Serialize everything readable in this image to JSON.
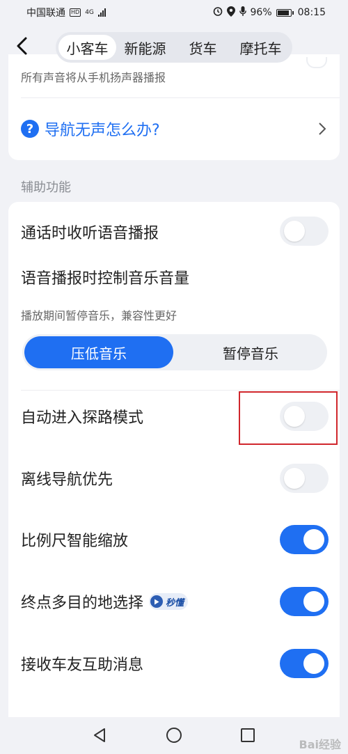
{
  "status_bar": {
    "carrier": "中国联通",
    "hd": "HD",
    "network": "4G",
    "battery": "96%",
    "time": "08:15"
  },
  "header": {
    "tabs": [
      "小客车",
      "新能源",
      "货车",
      "摩托车"
    ],
    "active_tab": "小客车"
  },
  "top_card": {
    "speaker_text": "所有声音将从手机扬声器播报",
    "help_link": "导航无声怎么办?"
  },
  "section_title": "辅助功能",
  "settings": {
    "call_broadcast": {
      "label": "通话时收听语音播报",
      "enabled": false
    },
    "music_control": {
      "label": "语音播报时控制音乐音量",
      "sub": "播放期间暂停音乐，兼容性更好",
      "options": [
        "压低音乐",
        "暂停音乐"
      ],
      "selected": "压低音乐"
    },
    "explore_mode": {
      "label": "自动进入探路模式",
      "enabled": false
    },
    "offline_first": {
      "label": "离线导航优先",
      "enabled": false
    },
    "smart_zoom": {
      "label": "比例尺智能缩放",
      "enabled": true
    },
    "multi_destination": {
      "label": "终点多目的地选择",
      "badge": "秒懂",
      "enabled": true
    },
    "rider_messages": {
      "label": "接收车友互助消息",
      "enabled": true
    }
  },
  "watermark": "Bai经验",
  "colors": {
    "accent": "#1f6ff2",
    "highlight": "#d0262c",
    "toggle_off": "#eef0f4"
  },
  "icons": {
    "back": "chevron-left-icon",
    "help": "question-circle-icon",
    "chevron": "chevron-right-icon"
  }
}
